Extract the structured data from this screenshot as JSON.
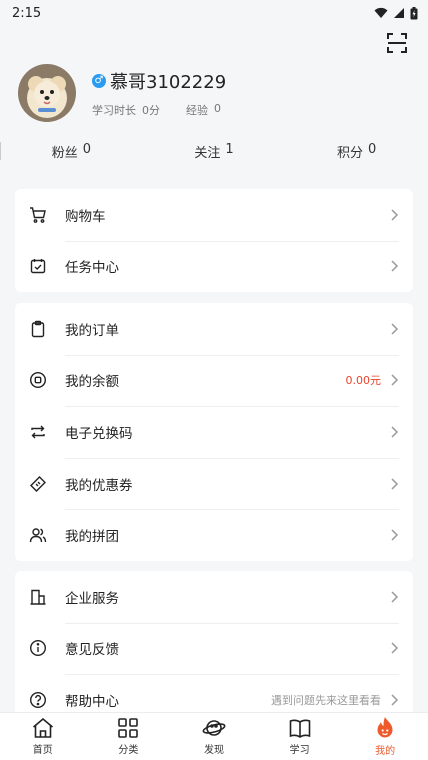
{
  "status_bar": {
    "time": "2:15"
  },
  "profile": {
    "username": "慕哥3102229",
    "gender_symbol": "♂",
    "study_time_label": "学习时长",
    "study_time_value": "0分",
    "exp_label": "经验",
    "exp_value": "0"
  },
  "stats": [
    {
      "label": "粉丝",
      "value": "0"
    },
    {
      "label": "关注",
      "value": "1"
    },
    {
      "label": "积分",
      "value": "0"
    }
  ],
  "menu_group_1": [
    {
      "label": "购物车",
      "icon": "cart-icon"
    },
    {
      "label": "任务中心",
      "icon": "calendar-check-icon"
    }
  ],
  "menu_group_2": [
    {
      "label": "我的订单",
      "icon": "clipboard-icon"
    },
    {
      "label": "我的余额",
      "icon": "coin-icon",
      "extra": "0.00元"
    },
    {
      "label": "电子兑换码",
      "icon": "exchange-icon"
    },
    {
      "label": "我的优惠券",
      "icon": "ticket-icon"
    },
    {
      "label": "我的拼团",
      "icon": "group-icon"
    }
  ],
  "menu_group_3": [
    {
      "label": "企业服务",
      "icon": "building-icon"
    },
    {
      "label": "意见反馈",
      "icon": "info-icon"
    },
    {
      "label": "帮助中心",
      "icon": "help-icon",
      "extra": "遇到问题先来这里看看"
    }
  ],
  "tabbar": [
    {
      "label": "首页",
      "icon": "home-icon"
    },
    {
      "label": "分类",
      "icon": "grid-icon"
    },
    {
      "label": "发现",
      "icon": "planet-icon"
    },
    {
      "label": "学习",
      "icon": "book-icon"
    },
    {
      "label": "我的",
      "icon": "flame-icon",
      "active": true
    }
  ],
  "colors": {
    "accent": "#ef5a2d",
    "balance": "#e8442b",
    "gender_badge": "#2a9bf0"
  }
}
